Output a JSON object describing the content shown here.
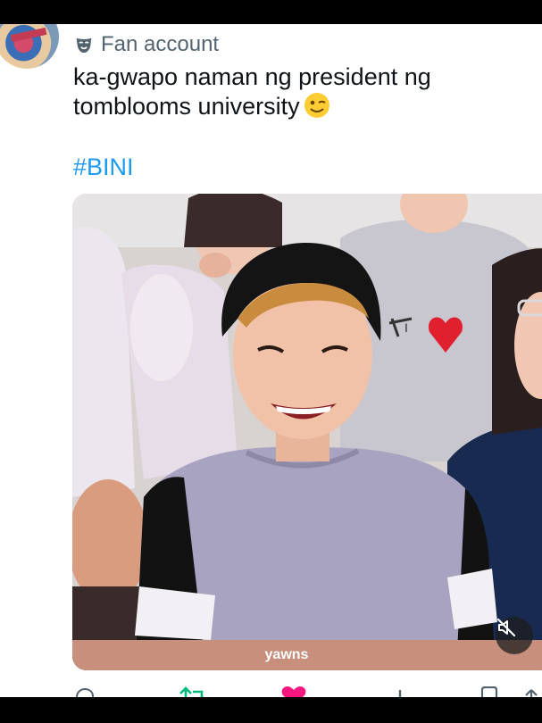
{
  "account": {
    "label": "Fan account",
    "label_icon": "mask-icon"
  },
  "tweet": {
    "text": "ka-gwapo naman ng president ng tomblooms university",
    "emoji": "winking-face-emoji",
    "hashtag": "#BINI"
  },
  "media": {
    "caption": "yawns",
    "caption_color": "#c78f7c",
    "mute_icon": "muted-speaker-icon"
  },
  "actions": {
    "reply_icon": "reply-icon",
    "retweet_icon": "retweet-icon",
    "retweet_color": "#00ba7c",
    "like_icon": "heart-icon",
    "like_color": "#f91880",
    "views_icon": "views-icon",
    "bookmark_icon": "bookmark-icon",
    "share_icon": "share-icon"
  }
}
